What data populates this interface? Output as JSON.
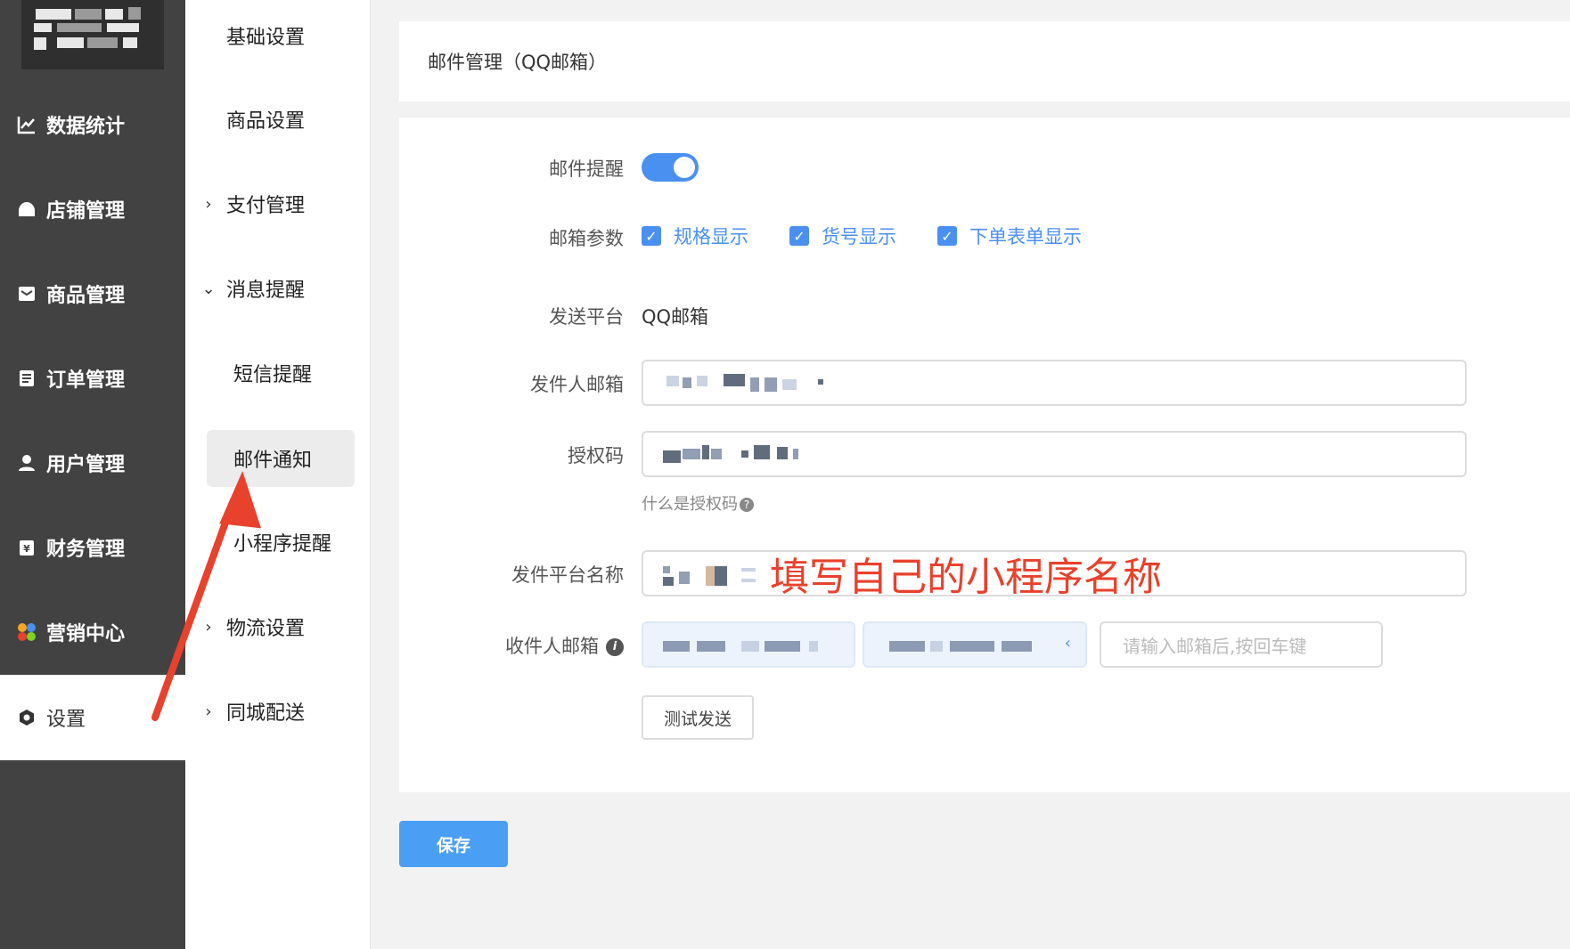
{
  "sidebar": {
    "items": [
      {
        "label": "数据统计",
        "icon": "chart-line-icon"
      },
      {
        "label": "店铺管理",
        "icon": "store-icon"
      },
      {
        "label": "商品管理",
        "icon": "mail-box-icon"
      },
      {
        "label": "订单管理",
        "icon": "order-list-icon"
      },
      {
        "label": "用户管理",
        "icon": "user-icon"
      },
      {
        "label": "财务管理",
        "icon": "finance-icon"
      },
      {
        "label": "营销中心",
        "icon": "marketing-icon"
      },
      {
        "label": "设置",
        "icon": "settings-icon",
        "active": true
      }
    ]
  },
  "submenu": {
    "items": [
      {
        "label": "基础设置"
      },
      {
        "label": "商品设置"
      },
      {
        "label": "支付管理",
        "expandable": true,
        "expanded": false
      },
      {
        "label": "消息提醒",
        "expandable": true,
        "expanded": true
      },
      {
        "label": "短信提醒",
        "child": true
      },
      {
        "label": "邮件通知",
        "child": true,
        "active": true
      },
      {
        "label": "小程序提醒",
        "child": true
      },
      {
        "label": "物流设置",
        "expandable": true,
        "expanded": false
      },
      {
        "label": "同城配送",
        "expandable": true,
        "expanded": false
      }
    ]
  },
  "header": {
    "title": "邮件管理（QQ邮箱）"
  },
  "form": {
    "email_reminder": {
      "label": "邮件提醒",
      "enabled": true
    },
    "email_params": {
      "label": "邮箱参数",
      "options": [
        {
          "label": "规格显示",
          "checked": true
        },
        {
          "label": "货号显示",
          "checked": true
        },
        {
          "label": "下单表单显示",
          "checked": true
        }
      ]
    },
    "platform": {
      "label": "发送平台",
      "value": "QQ邮箱"
    },
    "sender_email": {
      "label": "发件人邮箱"
    },
    "auth_code": {
      "label": "授权码",
      "hint": "什么是授权码"
    },
    "platform_name": {
      "label": "发件平台名称",
      "annotation": "填写自己的小程序名称"
    },
    "recipient": {
      "label": "收件人邮箱",
      "placeholder": "请输入邮箱后,按回车键"
    },
    "test_button": "测试发送"
  },
  "save_button": "保存",
  "colors": {
    "accent": "#4a90f0",
    "annotation": "#e8412c",
    "sidebar_bg": "#424242"
  }
}
